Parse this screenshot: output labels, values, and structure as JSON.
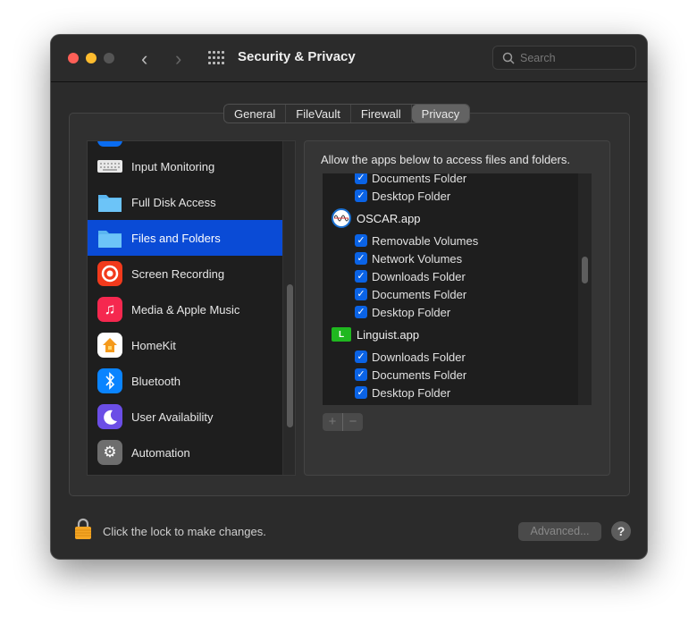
{
  "window": {
    "title": "Security & Privacy",
    "search_placeholder": "Search"
  },
  "tabs": [
    {
      "label": "General"
    },
    {
      "label": "FileVault"
    },
    {
      "label": "Firewall"
    },
    {
      "label": "Privacy",
      "active": true
    }
  ],
  "sidebar": {
    "items": [
      {
        "label": "Input Monitoring",
        "icon": "keyboard-icon"
      },
      {
        "label": "Full Disk Access",
        "icon": "folder-icon"
      },
      {
        "label": "Files and Folders",
        "icon": "folder-icon",
        "selected": true
      },
      {
        "label": "Screen Recording",
        "icon": "record-icon"
      },
      {
        "label": "Media & Apple Music",
        "icon": "music-note-icon"
      },
      {
        "label": "HomeKit",
        "icon": "home-icon"
      },
      {
        "label": "Bluetooth",
        "icon": "bluetooth-icon"
      },
      {
        "label": "User Availability",
        "icon": "moon-icon"
      },
      {
        "label": "Automation",
        "icon": "gear-icon"
      }
    ]
  },
  "panel": {
    "heading": "Allow the apps below to access files and folders.",
    "prior_items": [
      {
        "label": "Documents Folder",
        "checked": true
      },
      {
        "label": "Desktop Folder",
        "checked": true
      }
    ],
    "apps": [
      {
        "name": "OSCAR.app",
        "items": [
          {
            "label": "Removable Volumes",
            "checked": true
          },
          {
            "label": "Network Volumes",
            "checked": true
          },
          {
            "label": "Downloads Folder",
            "checked": true
          },
          {
            "label": "Documents Folder",
            "checked": true
          },
          {
            "label": "Desktop Folder",
            "checked": true
          }
        ]
      },
      {
        "name": "Linguist.app",
        "icon_letter": "L",
        "items": [
          {
            "label": "Downloads Folder",
            "checked": true
          },
          {
            "label": "Documents Folder",
            "checked": true
          },
          {
            "label": "Desktop Folder",
            "checked": true
          }
        ]
      }
    ],
    "add_label": "+",
    "remove_label": "−"
  },
  "footer": {
    "lock_text": "Click the lock to make changes.",
    "advanced_label": "Advanced...",
    "help_label": "?"
  },
  "colors": {
    "accent": "#0a4bd6",
    "checkbox": "#0a63e6"
  }
}
